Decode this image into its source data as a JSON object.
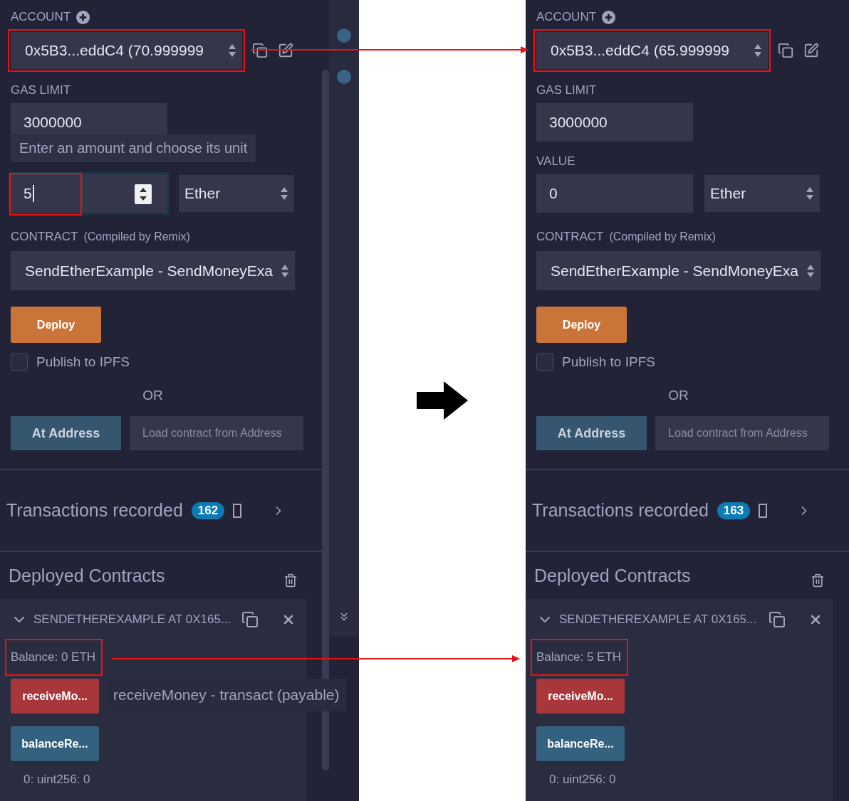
{
  "panels": [
    {
      "account_label": "ACCOUNT",
      "account": {
        "value": "0x5B3...eddC4 (70.999999",
        "highlighted": true
      },
      "gas_limit_label": "GAS LIMIT",
      "gas_limit": "3000000",
      "tooltip": "Enter an amount and choose its unit",
      "value": {
        "value": "5",
        "focused": true,
        "highlighted": true
      },
      "unit": "Ether",
      "contract_label": "CONTRACT",
      "contract_note": "(Compiled by Remix)",
      "contract": "SendEtherExample - SendMoneyExa",
      "deploy": "Deploy",
      "publish": {
        "label": "Publish to IPFS",
        "checked": false
      },
      "or": "OR",
      "at_address": "At Address",
      "at_address_placeholder": "Load contract from Address",
      "transactions": {
        "label": "Transactions recorded",
        "count": "162"
      },
      "deployed_title": "Deployed Contracts",
      "instance": {
        "title": "SENDETHEREXAMPLE AT 0X165...",
        "expanded": true
      },
      "balance": {
        "text": "Balance: 0 ETH",
        "highlighted": true
      },
      "functions": [
        {
          "label": "receiveMo...",
          "kind": "transact",
          "tooltip": "receiveMoney - transact (payable)"
        },
        {
          "label": "balanceRe...",
          "kind": "call"
        }
      ],
      "output": "0: uint256: 0",
      "side_strip": true
    },
    {
      "account_label": "ACCOUNT",
      "account": {
        "value": "0x5B3...eddC4 (65.999999",
        "highlighted": true
      },
      "gas_limit_label": "GAS LIMIT",
      "gas_limit": "3000000",
      "value_label": "VALUE",
      "value": {
        "value": "0",
        "focused": false,
        "highlighted": false
      },
      "unit": "Ether",
      "contract_label": "CONTRACT",
      "contract_note": "(Compiled by Remix)",
      "contract": "SendEtherExample - SendMoneyExa",
      "deploy": "Deploy",
      "publish": {
        "label": "Publish to IPFS",
        "checked": false
      },
      "or": "OR",
      "at_address": "At Address",
      "at_address_placeholder": "Load contract from Address",
      "transactions": {
        "label": "Transactions recorded",
        "count": "163"
      },
      "deployed_title": "Deployed Contracts",
      "instance": {
        "title": "SENDETHEREXAMPLE AT 0X165...",
        "expanded": true
      },
      "balance": {
        "text": "Balance: 5 ETH",
        "highlighted": true
      },
      "functions": [
        {
          "label": "receiveMo...",
          "kind": "transact"
        },
        {
          "label": "balanceRe...",
          "kind": "call"
        }
      ],
      "output": "0: uint256: 0",
      "side_strip": false
    }
  ]
}
